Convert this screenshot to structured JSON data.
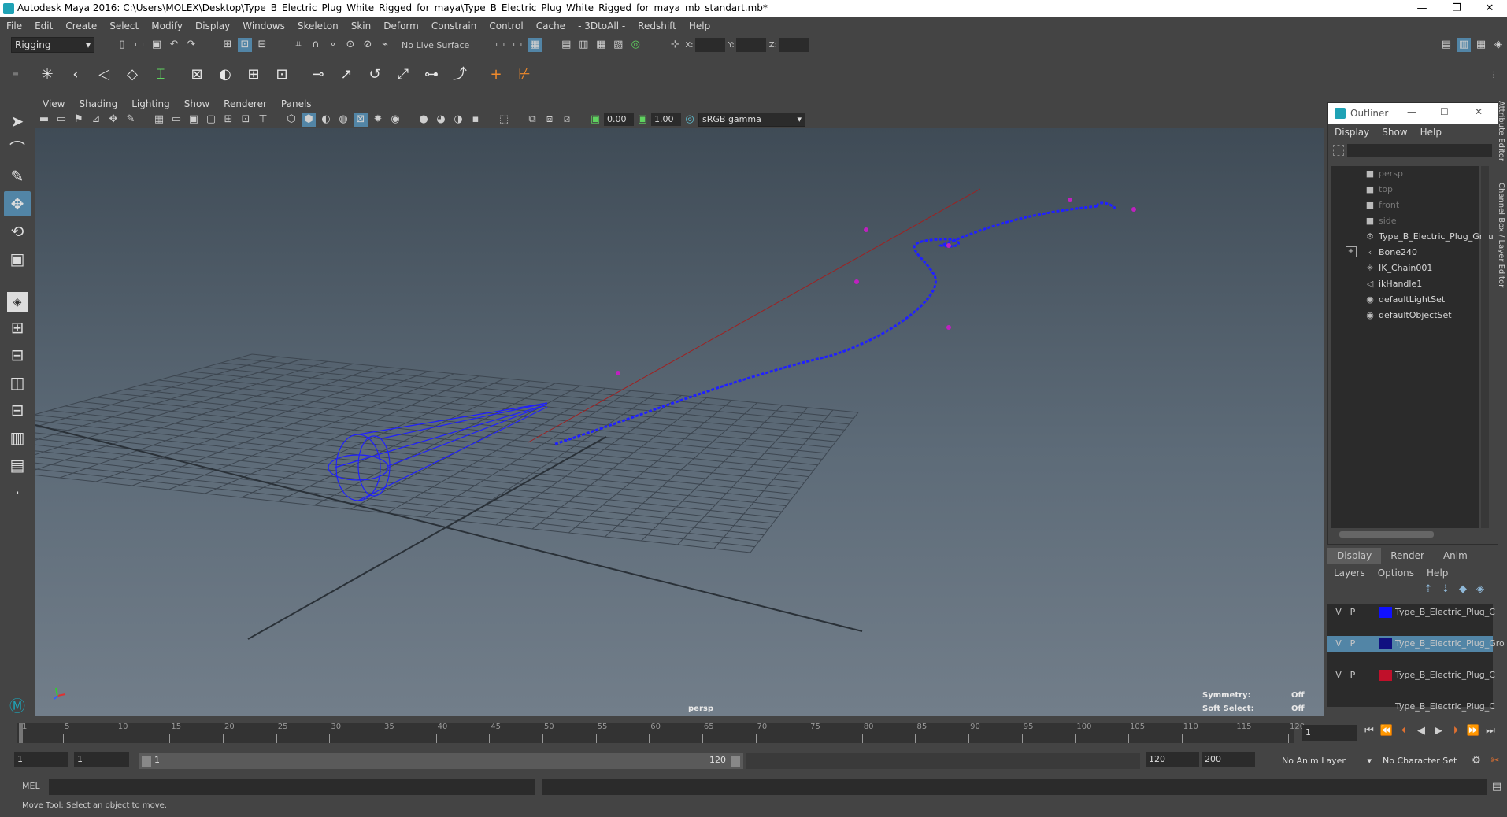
{
  "window": {
    "title": "Autodesk Maya 2016: C:\\Users\\MOLEX\\Desktop\\Type_B_Electric_Plug_White_Rigged_for_maya\\Type_B_Electric_Plug_White_Rigged_for_maya_mb_standart.mb*",
    "minimize": "—",
    "restore": "❐",
    "close": "✕"
  },
  "menubar": [
    "File",
    "Edit",
    "Create",
    "Select",
    "Modify",
    "Display",
    "Windows",
    "Skeleton",
    "Skin",
    "Deform",
    "Constrain",
    "Control",
    "Cache",
    "- 3DtoAll -",
    "Redshift",
    "Help"
  ],
  "statusline": {
    "mode": "Rigging",
    "live_surface": "No Live Surface",
    "x_label": "X:",
    "y_label": "Y:",
    "z_label": "Z:"
  },
  "viewport": {
    "menu": [
      "View",
      "Shading",
      "Lighting",
      "Show",
      "Renderer",
      "Panels"
    ],
    "exposure": "0.00",
    "gamma": "1.00",
    "color_space": "sRGB gamma",
    "camera_label": "persp",
    "symmetry_label": "Symmetry:",
    "symmetry_value": "Off",
    "softselect_label": "Soft Select:",
    "softselect_value": "Off"
  },
  "outliner": {
    "title": "Outliner",
    "menu": [
      "Display",
      "Show",
      "Help"
    ],
    "items": [
      {
        "label": "persp",
        "dim": true
      },
      {
        "label": "top",
        "dim": true
      },
      {
        "label": "front",
        "dim": true
      },
      {
        "label": "side",
        "dim": true
      },
      {
        "label": "Type_B_Electric_Plug_Grou",
        "dim": false
      },
      {
        "label": "Bone240",
        "dim": false
      },
      {
        "label": "IK_Chain001",
        "dim": false
      },
      {
        "label": "ikHandle1",
        "dim": false
      },
      {
        "label": "defaultLightSet",
        "dim": false
      },
      {
        "label": "defaultObjectSet",
        "dim": false
      }
    ],
    "expand_symbol": "+",
    "side_tabs": [
      "Attribute Editor",
      "Channel Box / Layer Editor"
    ]
  },
  "layer_editor": {
    "tabs": [
      "Display",
      "Render",
      "Anim"
    ],
    "menu": [
      "Layers",
      "Options",
      "Help"
    ],
    "layers": [
      {
        "v": "V",
        "p": "P",
        "color": "#1010ff",
        "name": "Type_B_Electric_Plug_C",
        "selected": false
      },
      {
        "v": "V",
        "p": "P",
        "color": "#101080",
        "name": "Type_B_Electric_Plug_Gro",
        "selected": true
      },
      {
        "v": "V",
        "p": "P",
        "color": "#c0102a",
        "name": "Type_B_Electric_Plug_C",
        "selected": false
      },
      {
        "v": "",
        "p": "",
        "color": "",
        "name": "Type_B_Electric_Plug_C",
        "selected": false
      }
    ]
  },
  "timeline": {
    "ticks": [
      "1",
      "5",
      "10",
      "15",
      "20",
      "25",
      "30",
      "35",
      "40",
      "45",
      "50",
      "55",
      "60",
      "65",
      "70",
      "75",
      "80",
      "85",
      "90",
      "95",
      "100",
      "105",
      "110",
      "115",
      "120"
    ],
    "current_frame": "1"
  },
  "range": {
    "start": "1",
    "playback_start": "1",
    "slider_start": "1",
    "slider_end": "120",
    "playback_end": "120",
    "end": "200",
    "anim_layer": "No Anim Layer",
    "character_set": "No Character Set"
  },
  "cmdline": {
    "label": "MEL"
  },
  "helpline": {
    "text": "Move Tool: Select an object to move."
  }
}
